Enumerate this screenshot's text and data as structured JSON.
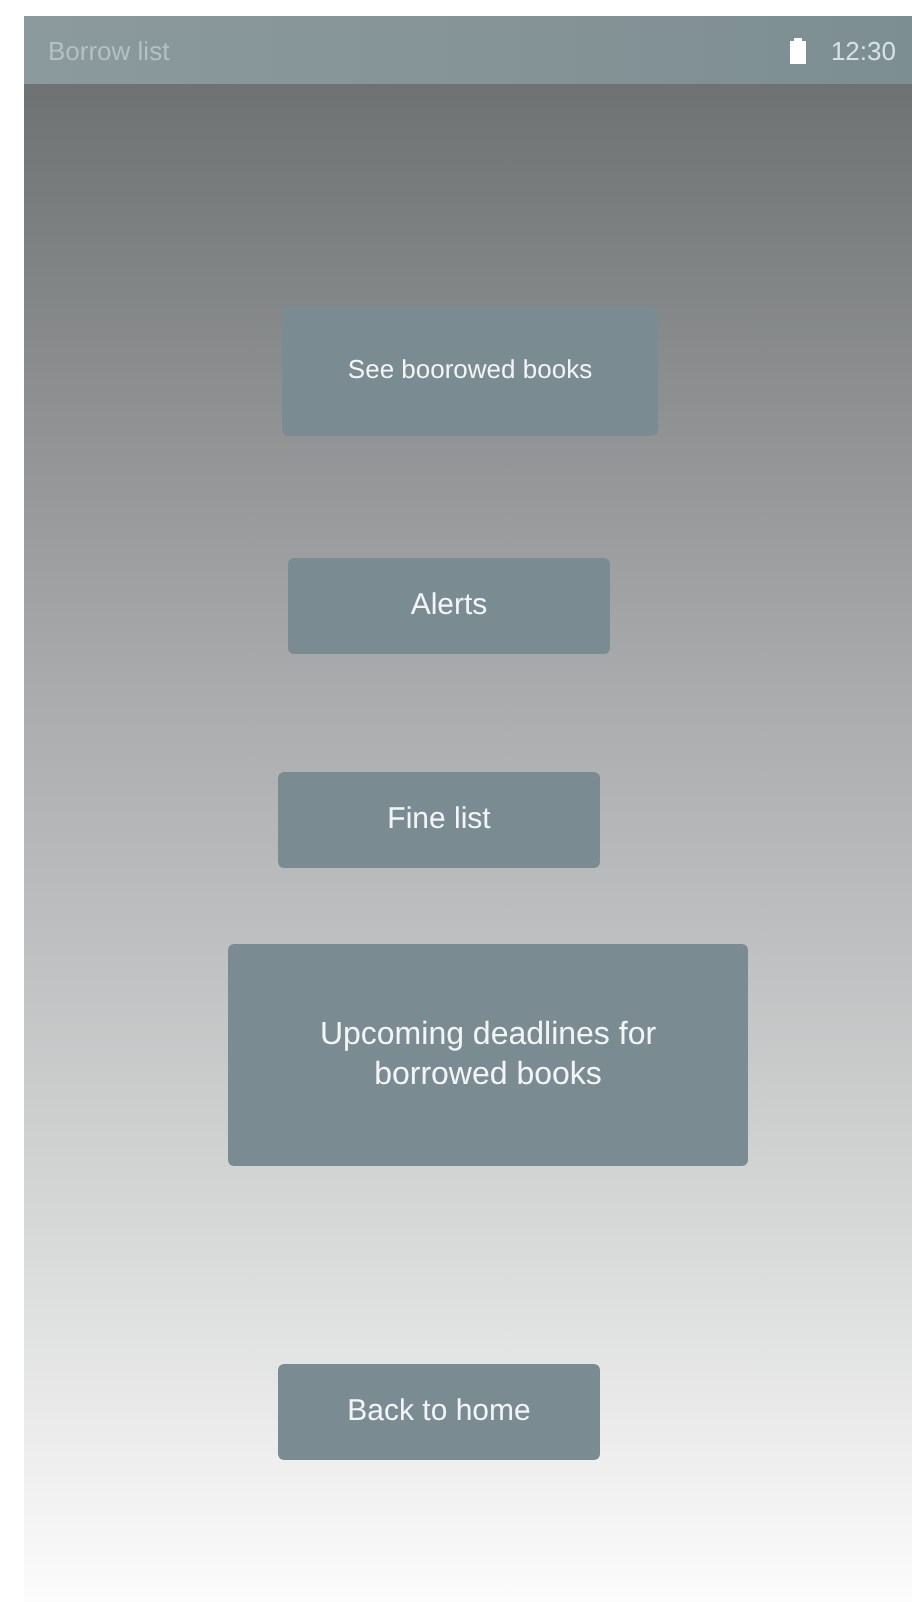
{
  "status_bar": {
    "title": "Borrow list",
    "time": "12:30"
  },
  "buttons": [
    {
      "label": "See boorowed books"
    },
    {
      "label": "Alerts"
    },
    {
      "label": "Fine list"
    },
    {
      "label": "Upcoming deadlines for borrowed books"
    },
    {
      "label": "Back to home"
    }
  ]
}
